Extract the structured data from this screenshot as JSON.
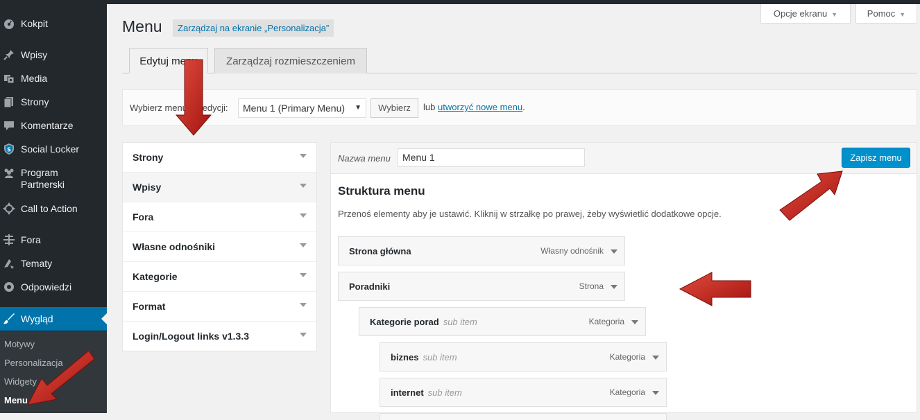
{
  "colors": {
    "sidebar_bg": "#23282d",
    "accent": "#0073aa",
    "save_button": "#0091cd",
    "annotation_arrow": "#cc1f1f"
  },
  "sidebar": {
    "items": [
      {
        "label": "Kokpit",
        "icon": "dashboard-icon"
      },
      {
        "label": "Wpisy",
        "icon": "pin-icon"
      },
      {
        "label": "Media",
        "icon": "media-icon"
      },
      {
        "label": "Strony",
        "icon": "page-icon"
      },
      {
        "label": "Komentarze",
        "icon": "comment-icon"
      },
      {
        "label": "Social Locker",
        "icon": "shield-icon"
      },
      {
        "label": "Program Partnerski",
        "icon": "group-icon"
      },
      {
        "label": "Call to Action",
        "icon": "move-icon"
      },
      {
        "label": "Fora",
        "icon": "forum-icon"
      },
      {
        "label": "Tematy",
        "icon": "topics-icon"
      },
      {
        "label": "Odpowiedzi",
        "icon": "replies-icon"
      },
      {
        "label": "Wygląd",
        "icon": "brush-icon"
      }
    ],
    "submenu": [
      "Motywy",
      "Personalizacja",
      "Widgety",
      "Menu"
    ]
  },
  "header": {
    "title": "Menu",
    "customize_link": "Zarządzaj na ekranie „Personalizacja”",
    "screen_options": "Opcje ekranu",
    "help": "Pomoc"
  },
  "tabs": [
    {
      "label": "Edytuj menu"
    },
    {
      "label": "Zarządzaj rozmieszczeniem"
    }
  ],
  "select_bar": {
    "label": "Wybierz menu do edycji:",
    "selected": "Menu 1 (Primary Menu)",
    "button": "Wybierz",
    "or_text": "lub",
    "create_link": "utworzyć nowe menu",
    "period": "."
  },
  "accordion": [
    "Strony",
    "Wpisy",
    "Fora",
    "Własne odnośniki",
    "Kategorie",
    "Format",
    "Login/Logout links v1.3.3"
  ],
  "menu_editor": {
    "name_label": "Nazwa menu",
    "name_value": "Menu 1",
    "save_button": "Zapisz menu",
    "structure_title": "Struktura menu",
    "structure_desc": "Przenoś elementy aby je ustawić. Kliknij w strzałkę po prawej, żeby wyświetlić dodatkowe opcje.",
    "items": [
      {
        "title": "Strona główna",
        "sub": "",
        "type": "Własny odnośnik"
      },
      {
        "title": "Poradniki",
        "sub": "",
        "type": "Strona"
      },
      {
        "title": "Kategorie porad",
        "sub": "sub item",
        "type": "Kategoria"
      },
      {
        "title": "biznes",
        "sub": "sub item",
        "type": "Kategoria"
      },
      {
        "title": "internet",
        "sub": "sub item",
        "type": "Kategoria"
      }
    ]
  }
}
